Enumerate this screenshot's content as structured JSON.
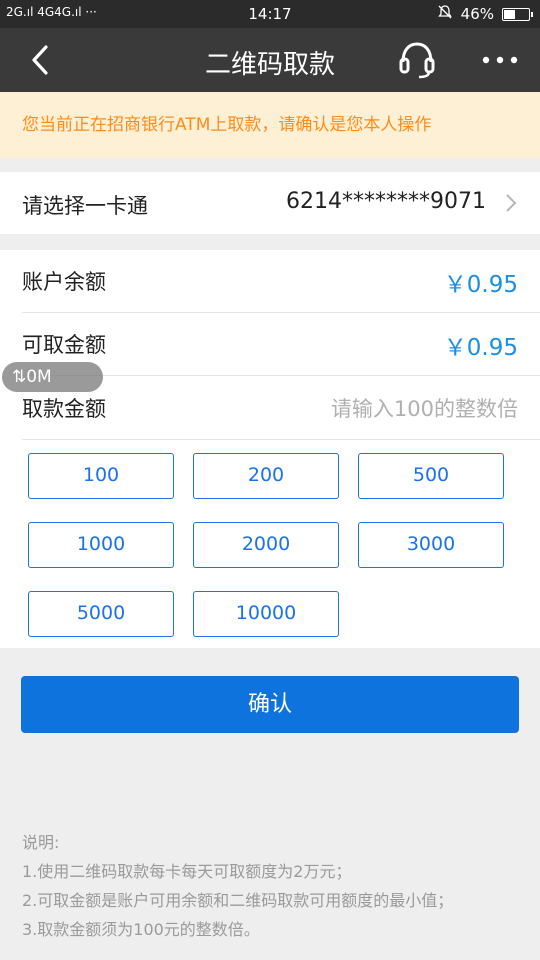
{
  "status_bar": {
    "signal": "2G.ıl 4G4G.ıl ···",
    "time": "14:17",
    "battery_text": "46%",
    "battery_level": 0.46
  },
  "nav": {
    "title": "二维码取款"
  },
  "notice": {
    "text": "您当前正在招商银行ATM上取款，请确认是您本人操作"
  },
  "card": {
    "label": "请选择一卡通",
    "number": "6214********9071"
  },
  "info": {
    "balance_label": "账户余额",
    "balance_value": "￥0.95",
    "available_label": "可取金额",
    "available_value": "￥0.95",
    "withdraw_label": "取款金额",
    "withdraw_placeholder": "请输入100的整数倍"
  },
  "amounts": [
    "100",
    "200",
    "500",
    "1000",
    "2000",
    "3000",
    "5000",
    "10000"
  ],
  "float_badge": "⇅0M",
  "confirm_label": "确认",
  "notes": [
    "说明:",
    "1.使用二维码取款每卡每天可取额度为2万元；",
    "2.可取金额是账户可用余额和二维码取款可用额度的最小值；",
    "3.取款金额须为100元的整数倍。"
  ],
  "colors": {
    "accent": "#0f73dd",
    "amount_blue": "#1a8fe3",
    "notice_text": "#ff8c1a",
    "notice_bg": "#fdf0d4"
  }
}
